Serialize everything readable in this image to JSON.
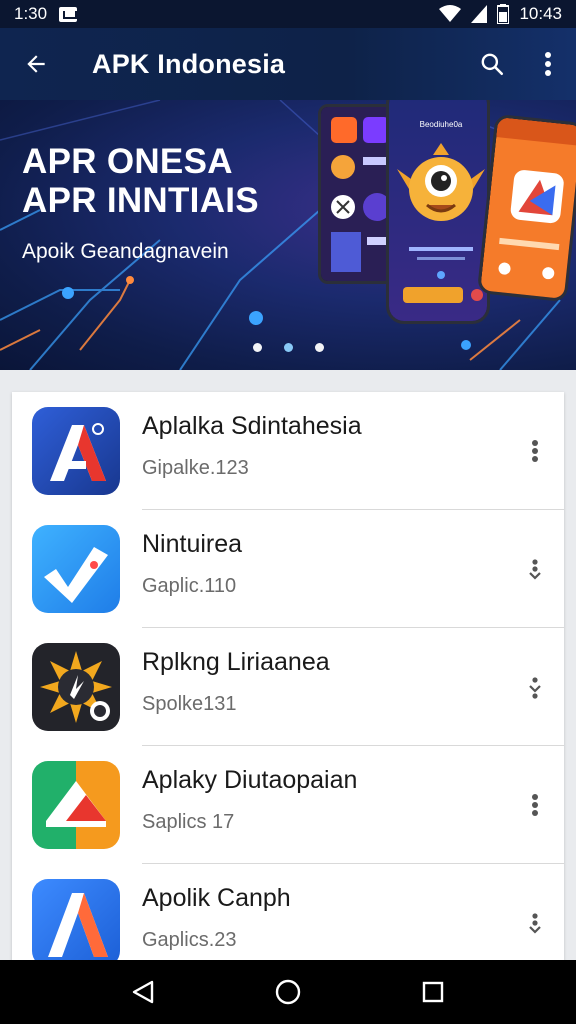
{
  "status_bar": {
    "time": "1:30",
    "right_text": "10:43"
  },
  "app_bar": {
    "title": "APK Indonesia"
  },
  "banner": {
    "headline_line1": "APR ONESA",
    "headline_line2": "APR INNTIAIS",
    "subtitle": "Apoik Geandagnavein",
    "phone_label": "Beodiuhe0a",
    "pages": 3,
    "active_page": 2
  },
  "apps": [
    {
      "name": "Aplalka Sdintahesia",
      "meta": "Gipalke.123",
      "icon": "letter-a-red-icon",
      "more": "more-vert-icon"
    },
    {
      "name": "Nintuirea",
      "meta": "Gaplic.110",
      "icon": "blue-check-app-icon",
      "more": "expand-icon"
    },
    {
      "name": "Rplkng Liriaanea",
      "meta": "Spolke131",
      "icon": "sunburst-app-icon",
      "more": "expand-icon"
    },
    {
      "name": "Aplaky Diutaopaian",
      "meta": "Saplics 17",
      "icon": "green-orange-app-icon",
      "more": "more-vert-icon"
    },
    {
      "name": "Apolik Canph",
      "meta": "Gaplics.23",
      "icon": "letter-a-blue-icon",
      "more": "expand-icon"
    }
  ],
  "colors": {
    "app_bar": "#0f2550",
    "accent": "#8fd3ff",
    "card_bg": "#ffffff"
  }
}
